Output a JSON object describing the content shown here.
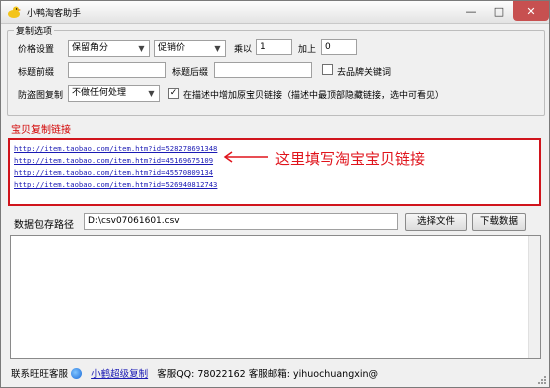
{
  "window": {
    "title": "小鸭淘客助手",
    "minimize_glyph": "—",
    "maximize_glyph": "□",
    "close_glyph": "✕"
  },
  "copy_options": {
    "group_title": "复制选项",
    "price_setting_label": "价格设置",
    "price_mode_value": "保留角分",
    "price_type_value": "促销价",
    "multiply_label": "乘以",
    "multiply_value": "1",
    "add_label": "加上",
    "add_value": "0",
    "title_prefix_label": "标题前缀",
    "title_prefix_value": "",
    "title_suffix_label": "标题后缀",
    "title_suffix_value": "",
    "remove_brand_label": "去品牌关键词",
    "remove_brand_checked": false,
    "anti_theft_label": "防盗图复制",
    "anti_theft_value": "不做任何处理",
    "add_original_link_label": "在描述中增加原宝贝链接（描述中最顶部隐藏链接，选中可看见）",
    "add_original_link_checked": true
  },
  "links_section": {
    "label": "宝贝复制链接",
    "links": [
      "http://item.taobao.com/item.htm?id=528278691348",
      "http://item.taobao.com/item.htm?id=45169675109",
      "http://item.taobao.com/item.htm?id=45570809134",
      "http://item.taobao.com/item.htm?id=526940812743"
    ],
    "annotation": "这里填写淘宝宝贝链接"
  },
  "save_path": {
    "label": "数据包存路径",
    "value": "D:\\csv07061601.csv",
    "choose_file_button": "选择文件",
    "download_button": "下载数据"
  },
  "footer": {
    "contact_label": "联系旺旺客服",
    "super_copy_link": "小鹤超级复制",
    "qq_text": "客服QQ: 78022162",
    "email_text": "客服邮箱: yihuochuangxin@"
  },
  "colors": {
    "accent_red": "#d0141c",
    "link_blue": "#1a1ab4",
    "close_button": "#c75050"
  }
}
